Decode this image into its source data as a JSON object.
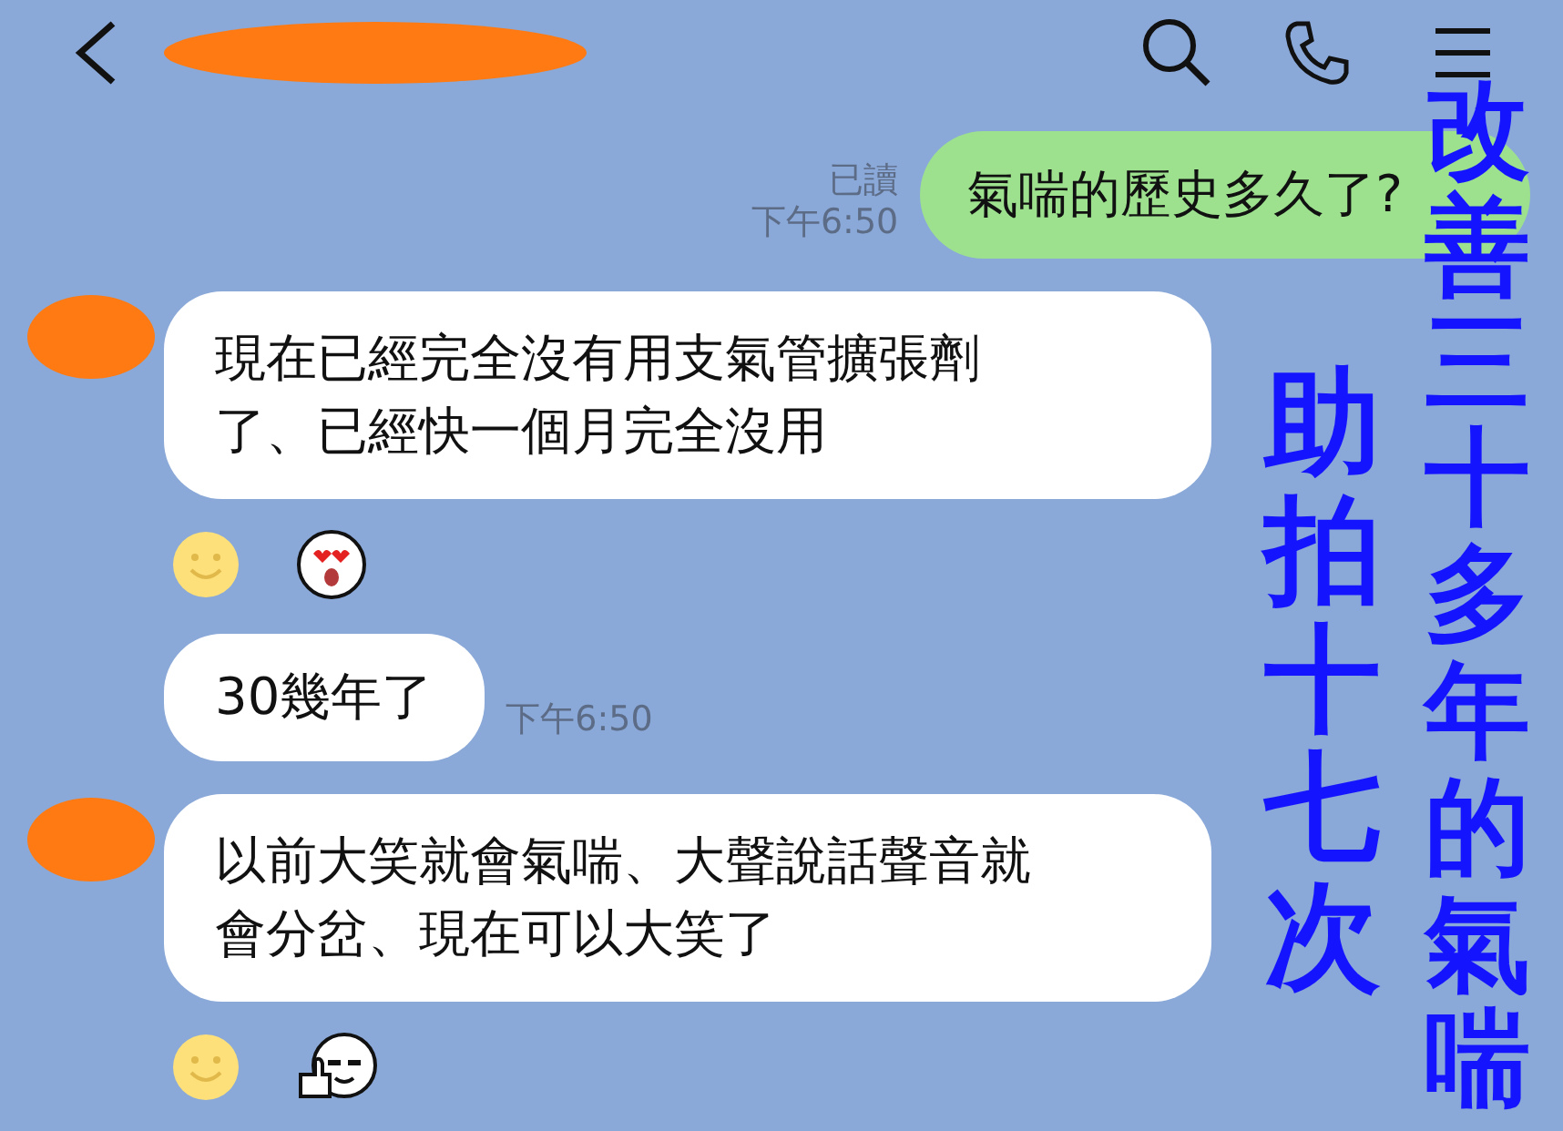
{
  "messages": [
    {
      "kind": "sent",
      "text": "氣喘的歷史多久了?",
      "read": "已讀",
      "time": "下午6:50"
    },
    {
      "kind": "received",
      "lines": [
        "現在已經完全沒有用支氣管擴張劑",
        "了、已經快一個月完全沒用"
      ],
      "avatar": true,
      "reaction": {
        "kind": "heart_eyes"
      }
    },
    {
      "kind": "received",
      "lines": [
        "30幾年了"
      ],
      "time": "下午6:50",
      "avatar": false
    },
    {
      "kind": "received",
      "lines": [
        "以前大笑就會氣喘、大聲說話聲音就",
        "會分岔、現在可以大笑了"
      ],
      "avatar": true,
      "reaction": {
        "kind": "thumbs_up"
      }
    }
  ],
  "overlay_captions": [
    "改善三十多年的氣喘",
    "助拍十七次"
  ]
}
